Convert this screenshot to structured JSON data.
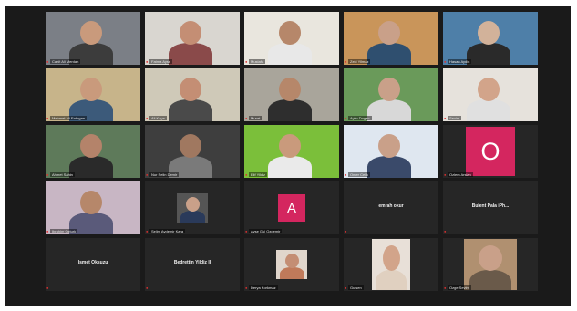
{
  "meeting": {
    "tiles": [
      {
        "name": "Cahit Ali Merdan",
        "type": "video",
        "bg": "#7b7f86",
        "skin": "#c99a7c",
        "shirt": "#3c3c3c"
      },
      {
        "name": "Fatma Ayse",
        "type": "video",
        "bg": "#d9d6d0",
        "skin": "#c48e74",
        "shirt": "#8a4a4a"
      },
      {
        "name": "Mustafa",
        "type": "video",
        "bg": "#e9e6de",
        "skin": "#b6876a",
        "shirt": "#e8e8e8"
      },
      {
        "name": "Zeki Yilmaz",
        "type": "video",
        "bg": "#c9955a",
        "skin": "#c9a089",
        "shirt": "#2f4f6f"
      },
      {
        "name": "Hasan Aydin",
        "type": "video",
        "bg": "#4e7fa8",
        "skin": "#d2b29a",
        "shirt": "#2a2a2a"
      },
      {
        "name": "Mehmet Ali Erdogan",
        "type": "video",
        "bg": "#c7b48a",
        "skin": "#c99a7c",
        "shirt": "#3c5a7a"
      },
      {
        "name": "Ali Kaya",
        "type": "video",
        "bg": "#cfc9b8",
        "skin": "#c48e74",
        "shirt": "#4a4a4a"
      },
      {
        "name": "Murat",
        "type": "video",
        "bg": "#a9a59b",
        "skin": "#b6876a",
        "shirt": "#2e2e2e"
      },
      {
        "name": "Aylin Dogan",
        "type": "video",
        "bg": "#6a9a5a",
        "skin": "#c9a089",
        "shirt": "#d8d8d8"
      },
      {
        "name": "Sevim",
        "type": "video",
        "bg": "#e6e2dc",
        "skin": "#d2a48a",
        "shirt": "#e0e0e0"
      },
      {
        "name": "Ahmet Sahin",
        "type": "video",
        "bg": "#5e7a5a",
        "skin": "#b4836a",
        "shirt": "#2a2a2a"
      },
      {
        "name": "Nur Selin Demir",
        "type": "video",
        "bg": "#3e3e3e",
        "skin": "#a07860",
        "shirt": "#7a7a7a"
      },
      {
        "name": "Elif Yildiz",
        "type": "video",
        "bg": "#7bbf3a",
        "skin": "#c99a7c",
        "shirt": "#eaeaea"
      },
      {
        "name": "Omer Celik",
        "type": "video",
        "bg": "#dfe7f0",
        "skin": "#c9a089",
        "shirt": "#3a4a6a"
      },
      {
        "name": "Ozlem Arslan",
        "type": "avatar",
        "letter": "O",
        "avatarSize": 54
      },
      {
        "name": "Ibrahim Ozturk",
        "type": "video",
        "bg": "#c8b6c4",
        "skin": "#b6876a",
        "shirt": "#5a5a7a"
      },
      {
        "name": "Selim Aydemir Kara",
        "type": "thumb",
        "bg": "#555",
        "skin": "#c9a089",
        "shirt": "#2a3a5a",
        "thumbW": 34,
        "thumbH": 32
      },
      {
        "name": "Ayse Gul Ozdemir",
        "type": "avatar",
        "letter": "A",
        "avatarSize": 30
      },
      {
        "name": "",
        "type": "text",
        "label": "emrah okur"
      },
      {
        "name": "",
        "type": "text",
        "label": "Bulent Pala  iPh..."
      },
      {
        "name": "",
        "type": "text",
        "label": "Ismet Oksuzu"
      },
      {
        "name": "",
        "type": "text",
        "label": "Bedrettin Yildiz II"
      },
      {
        "name": "Derya Korkmaz",
        "type": "thumb",
        "bg": "#e0d6cc",
        "skin": "#c48e74",
        "shirt": "#c07a5a",
        "thumbW": 34,
        "thumbH": 32
      },
      {
        "name": "Gulsen",
        "type": "thumb",
        "bg": "#e8e0d8",
        "skin": "#d2a48a",
        "shirt": "#e0d0c0",
        "thumbW": 42,
        "thumbH": 56
      },
      {
        "name": "Ozge Sevim",
        "type": "thumb",
        "bg": "#b09070",
        "skin": "#c9a089",
        "shirt": "#6a5a4a",
        "thumbW": 58,
        "thumbH": 56
      }
    ]
  }
}
